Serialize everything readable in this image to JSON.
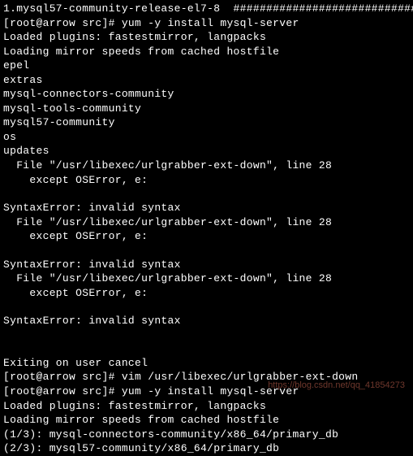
{
  "lines": {
    "cutoff": "1.mysql57-community-release-el7-8  ################################",
    "prompt1": "[root@arrow src]# yum -y install mysql-server",
    "loaded": "Loaded plugins: fastestmirror, langpacks",
    "loading": "Loading mirror speeds from cached hostfile",
    "epel": "epel",
    "extras": "extras",
    "connectors": "mysql-connectors-community",
    "tools": "mysql-tools-community",
    "mysql57": "mysql57-community",
    "os": "os",
    "updates": "updates",
    "file28": "  File \"/usr/libexec/urlgrabber-ext-down\", line 28",
    "except": "    except OSError, e:",
    "syntaxerr": "SyntaxError: invalid syntax",
    "exiting": "Exiting on user cancel",
    "prompt2": "[root@arrow src]# vim /usr/libexec/urlgrabber-ext-down",
    "prompt3": "[root@arrow src]# yum -y install mysql-server",
    "loaded2": "Loaded plugins: fastestmirror, langpacks",
    "loading2": "Loading mirror speeds from cached hostfile",
    "prog1": "(1/3): mysql-connectors-community/x86_64/primary_db",
    "prog2": "(2/3): mysql57-community/x86_64/primary_db"
  },
  "watermark": "https://blog.csdn.net/qq_41854273"
}
